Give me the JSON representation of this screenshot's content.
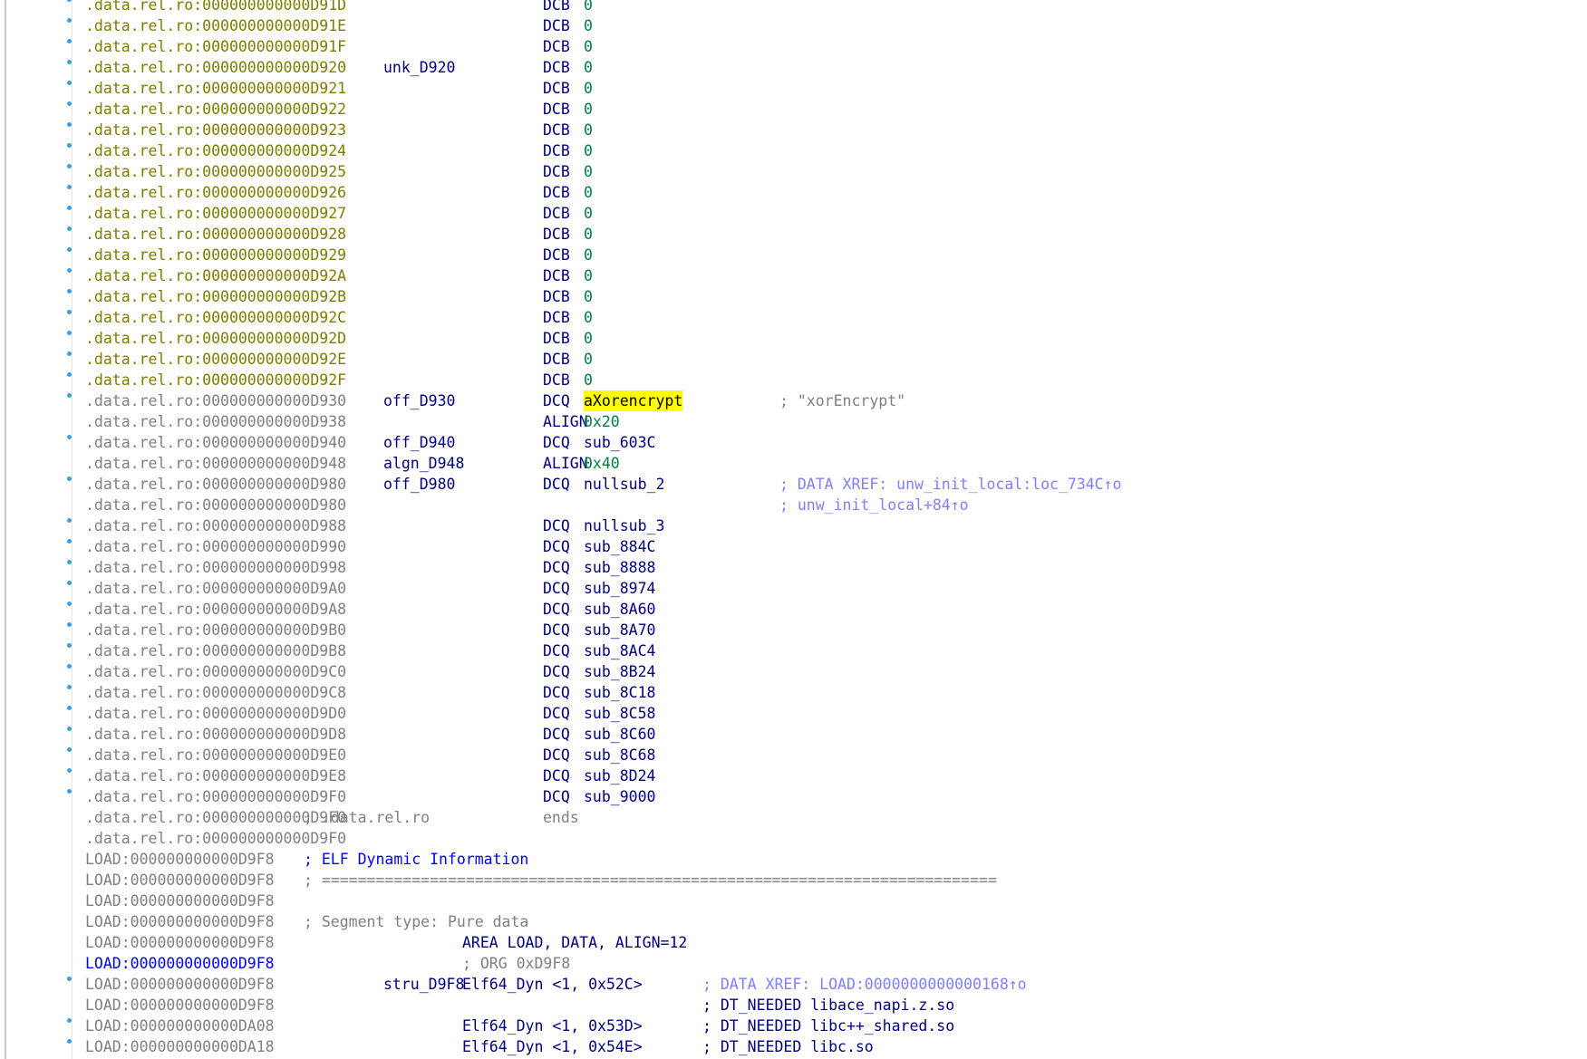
{
  "lines": [
    {
      "dot": true,
      "addr": ".data.rel.ro:000000000000D91D",
      "addr_style": "y",
      "mnemonic": "DCB",
      "operand": "0",
      "operand_style": "grn"
    },
    {
      "dot": true,
      "addr": ".data.rel.ro:000000000000D91E",
      "addr_style": "y",
      "mnemonic": "DCB",
      "operand": "0",
      "operand_style": "grn"
    },
    {
      "dot": true,
      "addr": ".data.rel.ro:000000000000D91F",
      "addr_style": "y",
      "mnemonic": "DCB",
      "operand": "0",
      "operand_style": "grn"
    },
    {
      "dot": true,
      "addr": ".data.rel.ro:000000000000D920",
      "addr_style": "y",
      "label": "unk_D920",
      "mnemonic": "DCB",
      "operand": "0",
      "operand_style": "grn"
    },
    {
      "dot": true,
      "addr": ".data.rel.ro:000000000000D921",
      "addr_style": "y",
      "mnemonic": "DCB",
      "operand": "0",
      "operand_style": "grn"
    },
    {
      "dot": true,
      "addr": ".data.rel.ro:000000000000D922",
      "addr_style": "y",
      "mnemonic": "DCB",
      "operand": "0",
      "operand_style": "grn"
    },
    {
      "dot": true,
      "addr": ".data.rel.ro:000000000000D923",
      "addr_style": "y",
      "mnemonic": "DCB",
      "operand": "0",
      "operand_style": "grn"
    },
    {
      "dot": true,
      "addr": ".data.rel.ro:000000000000D924",
      "addr_style": "y",
      "mnemonic": "DCB",
      "operand": "0",
      "operand_style": "grn"
    },
    {
      "dot": true,
      "addr": ".data.rel.ro:000000000000D925",
      "addr_style": "y",
      "mnemonic": "DCB",
      "operand": "0",
      "operand_style": "grn"
    },
    {
      "dot": true,
      "addr": ".data.rel.ro:000000000000D926",
      "addr_style": "y",
      "mnemonic": "DCB",
      "operand": "0",
      "operand_style": "grn"
    },
    {
      "dot": true,
      "addr": ".data.rel.ro:000000000000D927",
      "addr_style": "y",
      "mnemonic": "DCB",
      "operand": "0",
      "operand_style": "grn"
    },
    {
      "dot": true,
      "addr": ".data.rel.ro:000000000000D928",
      "addr_style": "y",
      "mnemonic": "DCB",
      "operand": "0",
      "operand_style": "grn"
    },
    {
      "dot": true,
      "addr": ".data.rel.ro:000000000000D929",
      "addr_style": "y",
      "mnemonic": "DCB",
      "operand": "0",
      "operand_style": "grn"
    },
    {
      "dot": true,
      "addr": ".data.rel.ro:000000000000D92A",
      "addr_style": "y",
      "mnemonic": "DCB",
      "operand": "0",
      "operand_style": "grn"
    },
    {
      "dot": true,
      "addr": ".data.rel.ro:000000000000D92B",
      "addr_style": "y",
      "mnemonic": "DCB",
      "operand": "0",
      "operand_style": "grn"
    },
    {
      "dot": true,
      "addr": ".data.rel.ro:000000000000D92C",
      "addr_style": "y",
      "mnemonic": "DCB",
      "operand": "0",
      "operand_style": "grn"
    },
    {
      "dot": true,
      "addr": ".data.rel.ro:000000000000D92D",
      "addr_style": "y",
      "mnemonic": "DCB",
      "operand": "0",
      "operand_style": "grn"
    },
    {
      "dot": true,
      "addr": ".data.rel.ro:000000000000D92E",
      "addr_style": "y",
      "mnemonic": "DCB",
      "operand": "0",
      "operand_style": "grn"
    },
    {
      "dot": true,
      "addr": ".data.rel.ro:000000000000D92F",
      "addr_style": "y",
      "mnemonic": "DCB",
      "operand": "0",
      "operand_style": "grn"
    },
    {
      "dot": true,
      "addr": ".data.rel.ro:000000000000D930",
      "addr_style": "g",
      "label": "off_D930",
      "mnemonic": "DCQ",
      "operand": "aXorencrypt",
      "operand_style": "hl",
      "comment": "; \"xorEncrypt\"",
      "comment_style": "gray"
    },
    {
      "dot": false,
      "addr": ".data.rel.ro:000000000000D938",
      "addr_style": "g",
      "mnemonic": "ALIGN",
      "operand": "0x20",
      "operand_style": "grn"
    },
    {
      "dot": true,
      "addr": ".data.rel.ro:000000000000D940",
      "addr_style": "g",
      "label": "off_D940",
      "mnemonic": "DCQ",
      "operand": "sub_603C",
      "operand_style": "nv"
    },
    {
      "dot": false,
      "addr": ".data.rel.ro:000000000000D948",
      "addr_style": "g",
      "label": "algn_D948",
      "mnemonic": "ALIGN",
      "operand": "0x40",
      "operand_style": "grn"
    },
    {
      "dot": true,
      "addr": ".data.rel.ro:000000000000D980",
      "addr_style": "g",
      "label": "off_D980",
      "mnemonic": "DCQ",
      "operand": "nullsub_2",
      "operand_style": "nv",
      "comment": "; DATA XREF: unw_init_local:loc_734C↑o",
      "comment_style": "xref"
    },
    {
      "dot": false,
      "addr": ".data.rel.ro:000000000000D980",
      "addr_style": "g",
      "comment": "; unw_init_local+84↑o",
      "comment_style": "xref"
    },
    {
      "dot": true,
      "addr": ".data.rel.ro:000000000000D988",
      "addr_style": "g",
      "mnemonic": "DCQ",
      "operand": "nullsub_3",
      "operand_style": "nv"
    },
    {
      "dot": true,
      "addr": ".data.rel.ro:000000000000D990",
      "addr_style": "g",
      "mnemonic": "DCQ",
      "operand": "sub_884C",
      "operand_style": "nv"
    },
    {
      "dot": true,
      "addr": ".data.rel.ro:000000000000D998",
      "addr_style": "g",
      "mnemonic": "DCQ",
      "operand": "sub_8888",
      "operand_style": "nv"
    },
    {
      "dot": true,
      "addr": ".data.rel.ro:000000000000D9A0",
      "addr_style": "g",
      "mnemonic": "DCQ",
      "operand": "sub_8974",
      "operand_style": "nv"
    },
    {
      "dot": true,
      "addr": ".data.rel.ro:000000000000D9A8",
      "addr_style": "g",
      "mnemonic": "DCQ",
      "operand": "sub_8A60",
      "operand_style": "nv"
    },
    {
      "dot": true,
      "addr": ".data.rel.ro:000000000000D9B0",
      "addr_style": "g",
      "mnemonic": "DCQ",
      "operand": "sub_8A70",
      "operand_style": "nv"
    },
    {
      "dot": true,
      "addr": ".data.rel.ro:000000000000D9B8",
      "addr_style": "g",
      "mnemonic": "DCQ",
      "operand": "sub_8AC4",
      "operand_style": "nv"
    },
    {
      "dot": true,
      "addr": ".data.rel.ro:000000000000D9C0",
      "addr_style": "g",
      "mnemonic": "DCQ",
      "operand": "sub_8B24",
      "operand_style": "nv"
    },
    {
      "dot": true,
      "addr": ".data.rel.ro:000000000000D9C8",
      "addr_style": "g",
      "mnemonic": "DCQ",
      "operand": "sub_8C18",
      "operand_style": "nv"
    },
    {
      "dot": true,
      "addr": ".data.rel.ro:000000000000D9D0",
      "addr_style": "g",
      "mnemonic": "DCQ",
      "operand": "sub_8C58",
      "operand_style": "nv"
    },
    {
      "dot": true,
      "addr": ".data.rel.ro:000000000000D9D8",
      "addr_style": "g",
      "mnemonic": "DCQ",
      "operand": "sub_8C60",
      "operand_style": "nv"
    },
    {
      "dot": true,
      "addr": ".data.rel.ro:000000000000D9E0",
      "addr_style": "g",
      "mnemonic": "DCQ",
      "operand": "sub_8C68",
      "operand_style": "nv"
    },
    {
      "dot": true,
      "addr": ".data.rel.ro:000000000000D9E8",
      "addr_style": "g",
      "mnemonic": "DCQ",
      "operand": "sub_8D24",
      "operand_style": "nv"
    },
    {
      "dot": true,
      "addr": ".data.rel.ro:000000000000D9F0",
      "addr_style": "g",
      "mnemonic": "DCQ",
      "operand": "sub_9000",
      "operand_style": "nv"
    },
    {
      "dot": false,
      "addr": ".data.rel.ro:000000000000D9F0",
      "addr_style": "g",
      "ends_comment": "; .data.rel.ro",
      "ends": "ends"
    },
    {
      "dot": false,
      "addr": ".data.rel.ro:000000000000D9F0",
      "addr_style": "g"
    },
    {
      "dot": false,
      "addr": "LOAD:000000000000D9F8",
      "addr_style": "g",
      "text_comment": "; ELF Dynamic Information",
      "text_style": "blue"
    },
    {
      "dot": false,
      "addr": "LOAD:000000000000D9F8",
      "addr_style": "g",
      "text_comment": "; ===========================================================================",
      "text_style": "gray"
    },
    {
      "dot": false,
      "addr": "LOAD:000000000000D9F8",
      "addr_style": "g"
    },
    {
      "dot": false,
      "addr": "LOAD:000000000000D9F8",
      "addr_style": "g",
      "text_comment": "; Segment type: Pure data",
      "text_style": "gray"
    },
    {
      "dot": false,
      "addr": "LOAD:000000000000D9F8",
      "addr_style": "g",
      "mnemonic_l": "AREA LOAD, DATA, ALIGN=12"
    },
    {
      "dot": false,
      "addr": "LOAD:000000000000D9F8",
      "addr_style": "gb",
      "mnemonic_l_comment": "; ORG 0xD9F8"
    },
    {
      "dot": true,
      "addr": "LOAD:000000000000D9F8",
      "addr_style": "g",
      "label": "stru_D9F8",
      "mnemonic_l": "Elf64_Dyn <1, 0x52C>",
      "comment_l": "; DATA XREF: LOAD:0000000000000168↑o",
      "comment_l_style": "xref"
    },
    {
      "dot": false,
      "addr": "LOAD:000000000000D9F8",
      "addr_style": "g",
      "comment_l": "; DT_NEEDED libace_napi.z.so",
      "comment_l_style": "nv"
    },
    {
      "dot": true,
      "addr": "LOAD:000000000000DA08",
      "addr_style": "g",
      "mnemonic_l": "Elf64_Dyn <1, 0x53D>",
      "comment_l": "; DT_NEEDED libc++_shared.so",
      "comment_l_style": "nv"
    },
    {
      "dot": true,
      "addr": "LOAD:000000000000DA18",
      "addr_style": "g",
      "mnemonic_l": "Elf64_Dyn <1, 0x54E>",
      "comment_l": "; DT_NEEDED libc.so",
      "comment_l_style": "nv"
    }
  ]
}
